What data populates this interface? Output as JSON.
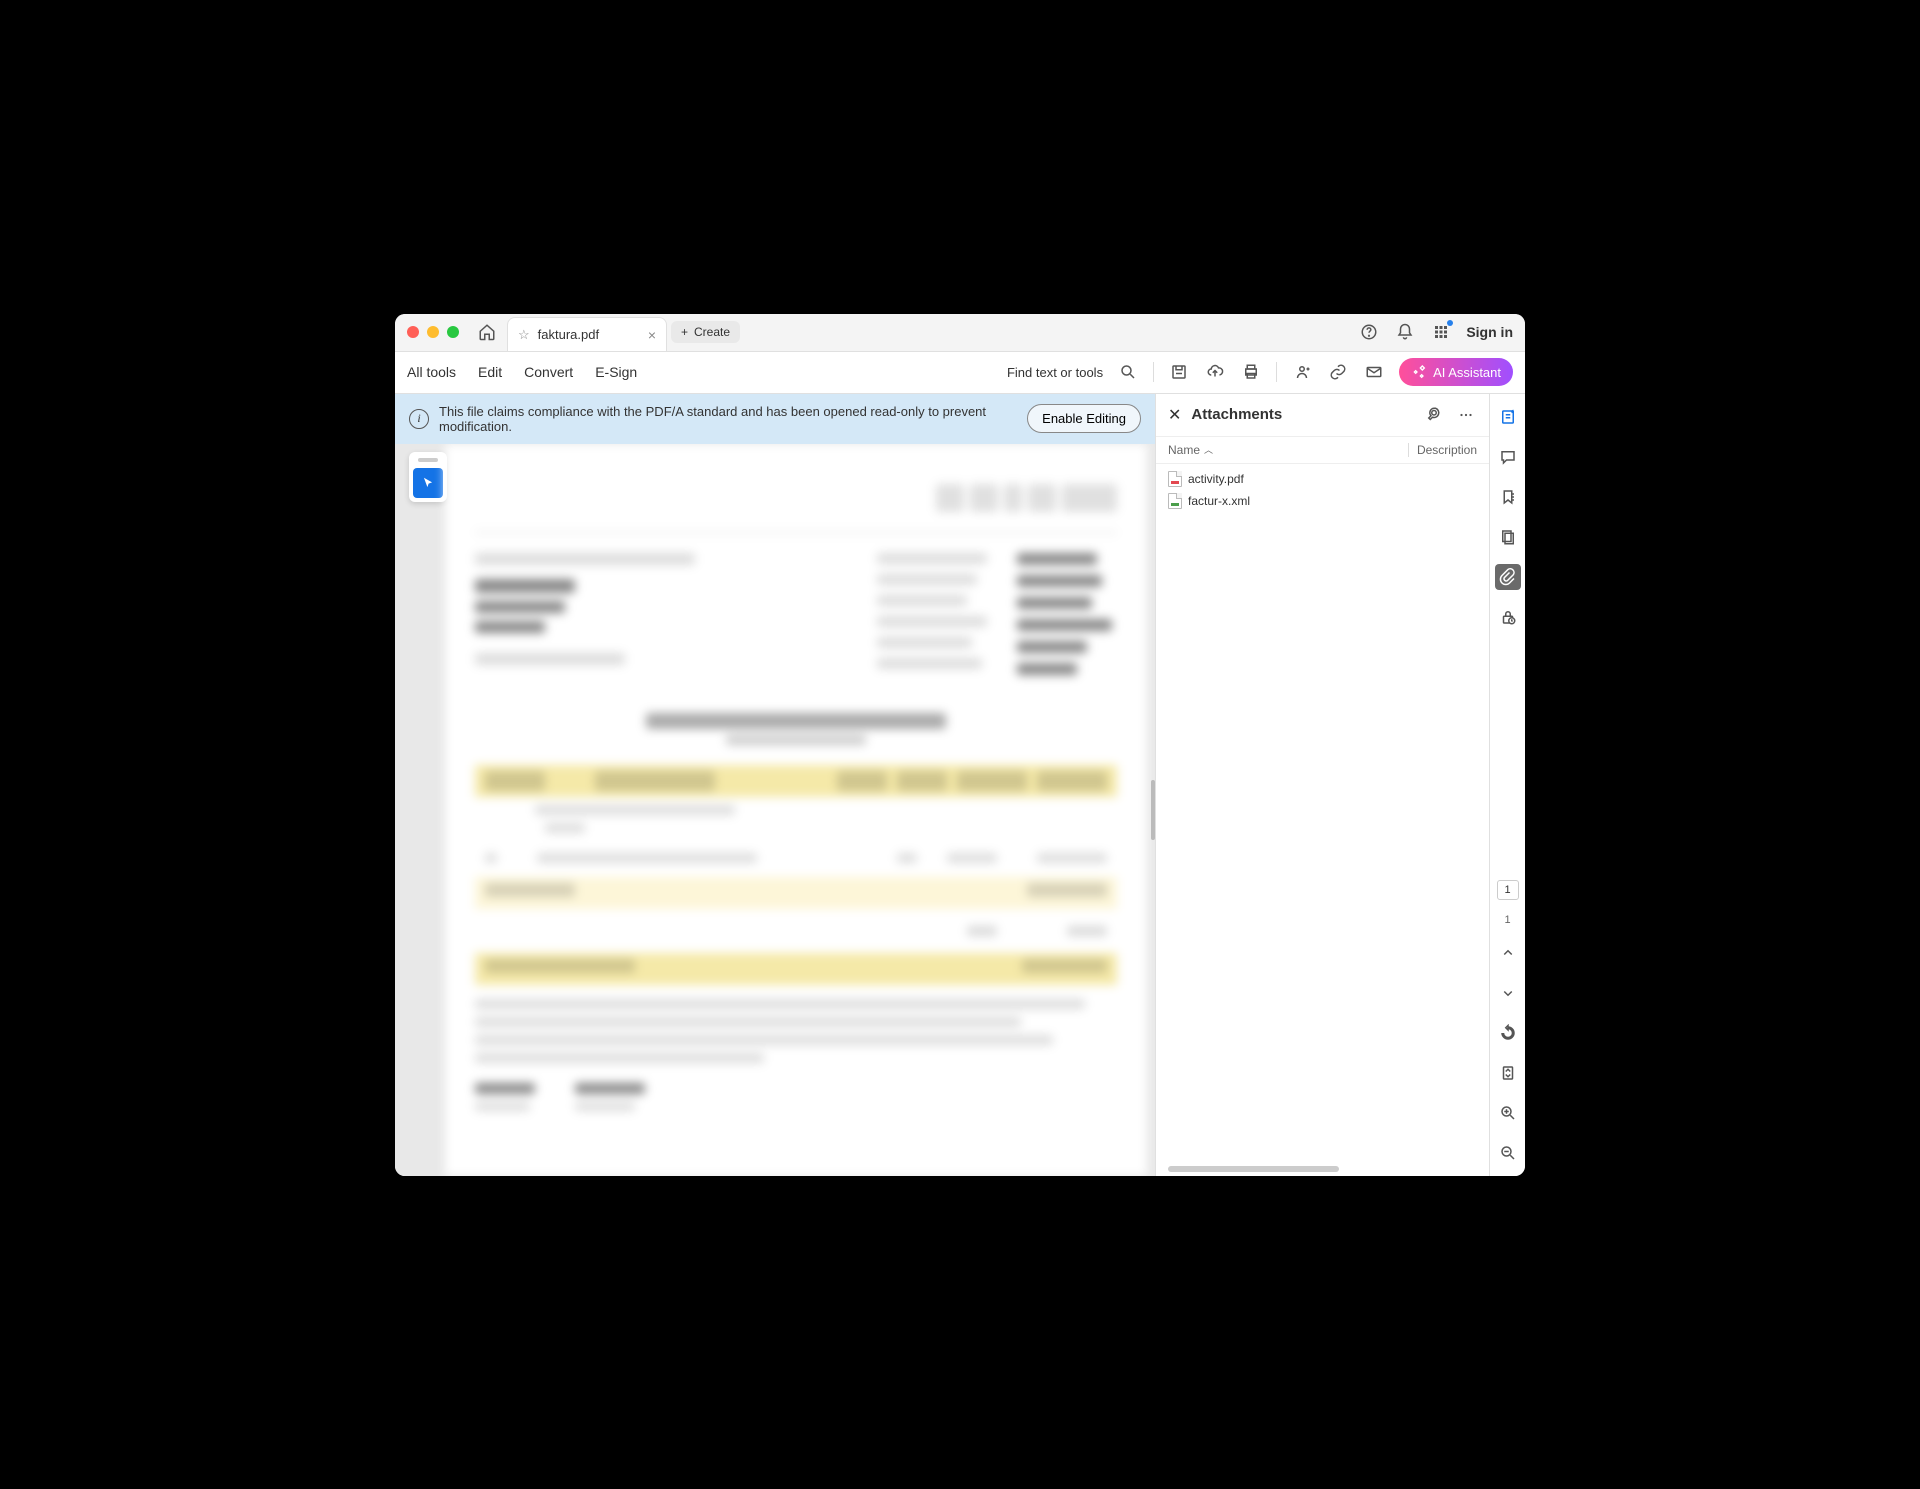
{
  "titlebar": {
    "tab_name": "faktura.pdf",
    "create_label": "Create",
    "signin_label": "Sign in"
  },
  "toolbar": {
    "all_tools": "All tools",
    "edit": "Edit",
    "convert": "Convert",
    "esign": "E-Sign",
    "find_label": "Find text or tools",
    "ai_label": "AI Assistant"
  },
  "banner": {
    "text": "This file claims compliance with the PDF/A standard and has been opened read-only to prevent modification.",
    "button": "Enable Editing"
  },
  "panel": {
    "title": "Attachments",
    "col_name": "Name",
    "col_desc": "Description",
    "items": [
      {
        "name": "activity.pdf",
        "type": "pdf"
      },
      {
        "name": "factur-x.xml",
        "type": "xml"
      }
    ]
  },
  "pagination": {
    "current": "1",
    "total": "1"
  }
}
